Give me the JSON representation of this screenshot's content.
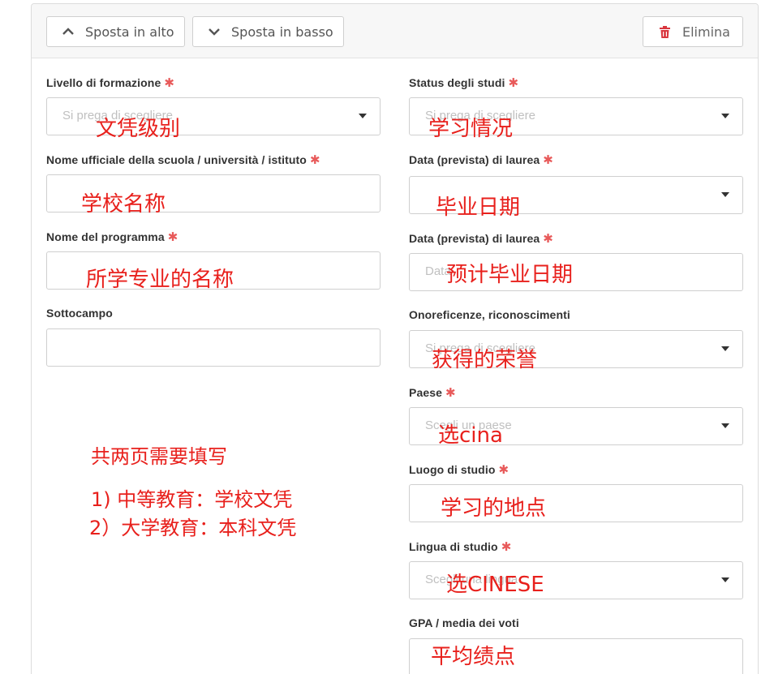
{
  "toolbar": {
    "move_up_label": "Sposta in alto",
    "move_down_label": "Sposta in basso",
    "delete_label": "Elimina"
  },
  "required_mark": "✱",
  "left": {
    "education_level": {
      "label": "Livello di formazione",
      "placeholder": "Si prega di scegliere"
    },
    "school_name": {
      "label": "Nome ufficiale della scuola / università / istituto"
    },
    "program_name": {
      "label": "Nome del programma"
    },
    "subfield": {
      "label": "Sottocampo"
    }
  },
  "right": {
    "study_status": {
      "label": "Status degli studi",
      "placeholder": "Si prega di scegliere"
    },
    "graduation_date": {
      "label": "Data (prevista) di laurea"
    },
    "expected_graduation_date": {
      "label": "Data (prevista) di laurea",
      "placeholder": "Data"
    },
    "honors": {
      "label": "Onoreficenze, riconoscimenti",
      "placeholder": "Si prega di scegliere"
    },
    "country": {
      "label": "Paese",
      "placeholder": "Scegli un paese"
    },
    "study_place": {
      "label": "Luogo di studio"
    },
    "study_language": {
      "label": "Lingua di studio",
      "placeholder": "Scegli una lingua"
    },
    "gpa": {
      "label": "GPA / media dei voti"
    }
  },
  "annotations": {
    "education_level": "文凭级别",
    "study_status": "学习情况",
    "school_name": "学校名称",
    "graduation_date": "毕业日期",
    "program_name": "所学专业的名称",
    "expected_graduation_date": "预计毕业日期",
    "honors": "获得的荣誉",
    "country": "选cina",
    "study_place": "学习的地点",
    "study_language": "选CINESE",
    "gpa": "平均绩点",
    "pages_note": "共两页需要填写",
    "note_1": "1) 中等教育：学校文凭",
    "note_2": "2）大学教育：本科文凭"
  },
  "colors": {
    "required": "#e85a5a",
    "annotation": "#e8201c",
    "delete_icon": "#d9363e"
  }
}
